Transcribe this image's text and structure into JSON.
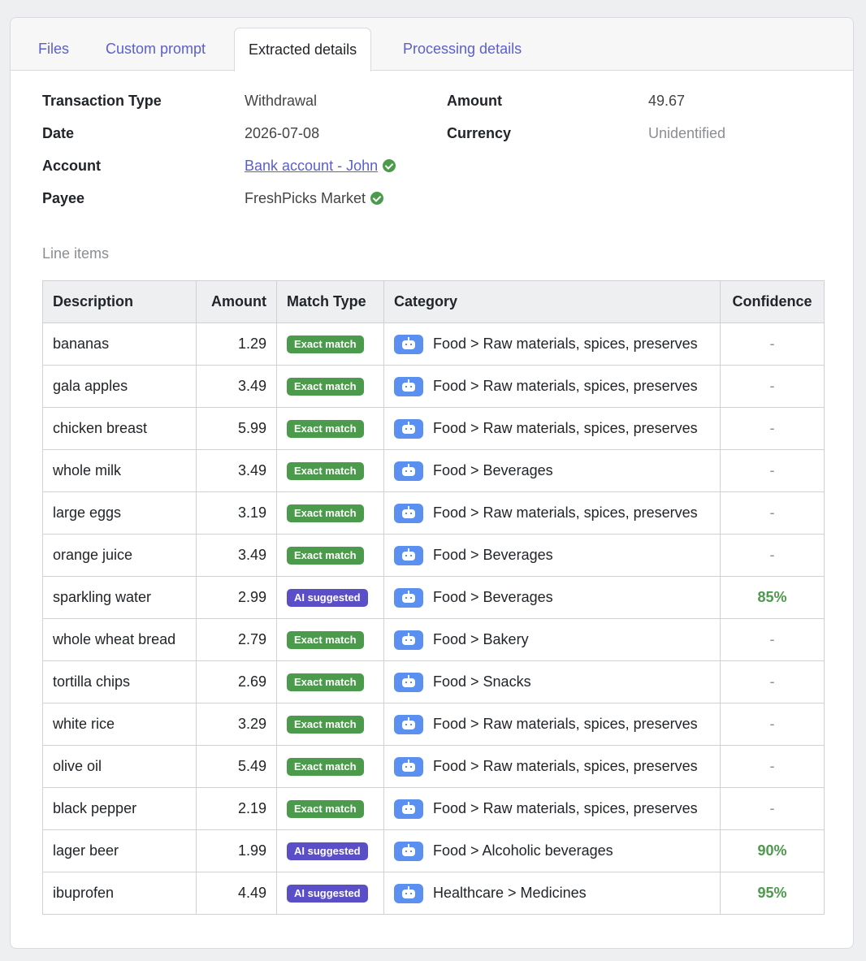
{
  "tabs": [
    {
      "label": "Files"
    },
    {
      "label": "Custom prompt"
    },
    {
      "label": "Extracted details"
    },
    {
      "label": "Processing details"
    }
  ],
  "details": {
    "transaction_type_label": "Transaction Type",
    "transaction_type_value": "Withdrawal",
    "date_label": "Date",
    "date_value": "2026-07-08",
    "account_label": "Account",
    "account_value": "Bank account - John",
    "payee_label": "Payee",
    "payee_value": "FreshPicks Market",
    "amount_label": "Amount",
    "amount_value": "49.67",
    "currency_label": "Currency",
    "currency_value": "Unidentified"
  },
  "line_items": {
    "title": "Line items",
    "columns": [
      "Description",
      "Amount",
      "Match Type",
      "Category",
      "Confidence"
    ],
    "rows": [
      {
        "description": "bananas",
        "amount": "1.29",
        "match": "Exact match",
        "category": "Food > Raw materials, spices, preserves",
        "confidence": "-"
      },
      {
        "description": "gala apples",
        "amount": "3.49",
        "match": "Exact match",
        "category": "Food > Raw materials, spices, preserves",
        "confidence": "-"
      },
      {
        "description": "chicken breast",
        "amount": "5.99",
        "match": "Exact match",
        "category": "Food > Raw materials, spices, preserves",
        "confidence": "-"
      },
      {
        "description": "whole milk",
        "amount": "3.49",
        "match": "Exact match",
        "category": "Food > Beverages",
        "confidence": "-"
      },
      {
        "description": "large eggs",
        "amount": "3.19",
        "match": "Exact match",
        "category": "Food > Raw materials, spices, preserves",
        "confidence": "-"
      },
      {
        "description": "orange juice",
        "amount": "3.49",
        "match": "Exact match",
        "category": "Food > Beverages",
        "confidence": "-"
      },
      {
        "description": "sparkling water",
        "amount": "2.99",
        "match": "AI suggested",
        "category": "Food > Beverages",
        "confidence": "85%"
      },
      {
        "description": "whole wheat bread",
        "amount": "2.79",
        "match": "Exact match",
        "category": "Food > Bakery",
        "confidence": "-"
      },
      {
        "description": "tortilla chips",
        "amount": "2.69",
        "match": "Exact match",
        "category": "Food > Snacks",
        "confidence": "-"
      },
      {
        "description": "white rice",
        "amount": "3.29",
        "match": "Exact match",
        "category": "Food > Raw materials, spices, preserves",
        "confidence": "-"
      },
      {
        "description": "olive oil",
        "amount": "5.49",
        "match": "Exact match",
        "category": "Food > Raw materials, spices, preserves",
        "confidence": "-"
      },
      {
        "description": "black pepper",
        "amount": "2.19",
        "match": "Exact match",
        "category": "Food > Raw materials, spices, preserves",
        "confidence": "-"
      },
      {
        "description": "lager beer",
        "amount": "1.99",
        "match": "AI suggested",
        "category": "Food > Alcoholic beverages",
        "confidence": "90%"
      },
      {
        "description": "ibuprofen",
        "amount": "4.49",
        "match": "AI suggested",
        "category": "Healthcare > Medicines",
        "confidence": "95%"
      }
    ]
  },
  "colors": {
    "accent": "#5b5fc7",
    "exact_badge": "#4c9a4c",
    "ai_badge": "#5b4fc7",
    "confidence": "#4c9a4c",
    "bot_icon": "#5b8ff0"
  },
  "icons": {
    "verified": "check-circle-icon",
    "category": "robot-icon"
  }
}
